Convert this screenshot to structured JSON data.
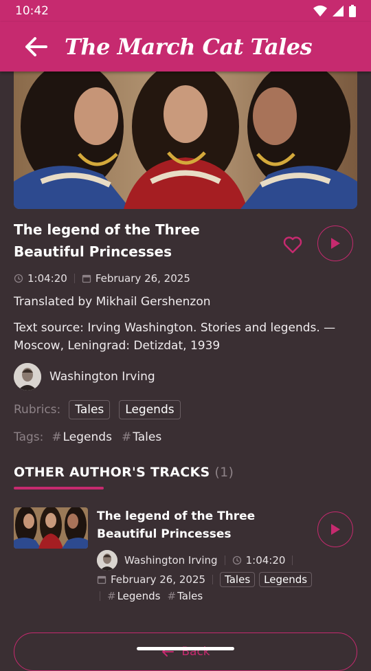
{
  "status_bar": {
    "time": "10:42"
  },
  "app_bar": {
    "title": "The March Cat Tales"
  },
  "track": {
    "title": "The legend of the Three Beautiful Princesses",
    "duration": "1:04:20",
    "date": "February 26, 2025",
    "translator": "Translated by Mikhail Gershenzon",
    "source": "Text source: Irving Washington. Stories and legends. — Moscow, Leningrad: Detizdat, 1939",
    "author": "Washington Irving",
    "rubrics_label": "Rubrics:",
    "rubrics": [
      "Tales",
      "Legends"
    ],
    "tags_label": "Tags:",
    "tags": [
      "Legends",
      "Tales"
    ]
  },
  "other_tracks": {
    "heading": "OTHER AUTHOR'S TRACKS",
    "count": "(1)",
    "items": [
      {
        "title": "The legend of the Three Beautiful Princesses",
        "author": "Washington Irving",
        "duration": "1:04:20",
        "date": "February 26, 2025",
        "rubrics": [
          "Tales",
          "Legends"
        ],
        "tags": [
          "Legends",
          "Tales"
        ]
      }
    ]
  },
  "back_button": {
    "label": "Back"
  },
  "colors": {
    "accent": "#c62a6f",
    "background": "#3a2f33"
  },
  "icons": [
    "back-arrow-icon",
    "heart-icon",
    "play-icon",
    "clock-icon",
    "calendar-icon",
    "wifi-icon",
    "signal-icon",
    "battery-icon"
  ]
}
